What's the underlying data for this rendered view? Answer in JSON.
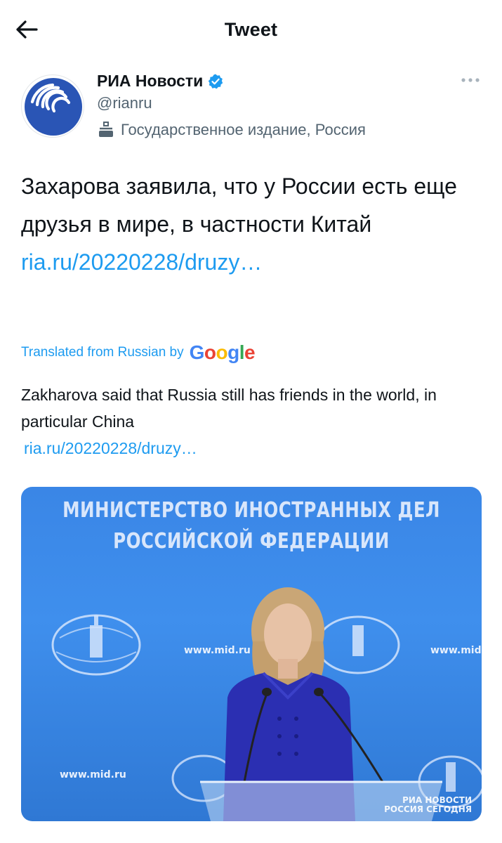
{
  "header": {
    "title": "Tweet"
  },
  "author": {
    "name": "РИА Новости",
    "handle": "@rianru",
    "label": "Государственное издание, Россия"
  },
  "tweet": {
    "text": "Захарова заявила, что у России есть еще друзья в мире, в частности Китай",
    "link": "ria.ru/20220228/druzy…"
  },
  "translation": {
    "note": "Translated from Russian by",
    "provider": "Google",
    "text": "Zakharova said that Russia still has friends in the world, in particular China",
    "link": "ria.ru/20220228/druzy…"
  },
  "media": {
    "banner_line1": "МИНИСТЕРСТВО ИНОСТРАННЫХ ДЕЛ",
    "banner_line2": "РОССИЙСКОЙ ФЕДЕРАЦИИ",
    "url_text": "www.mid.ru",
    "watermark_line1": "РИА НОВОСТИ",
    "watermark_line2": "РОССИЯ СЕГОДНЯ"
  },
  "colors": {
    "link": "#1d9bf0",
    "verified": "#1d9bf0",
    "secondary_text": "#536471",
    "media_background": "#3a86e6"
  },
  "icons": {
    "back": "arrow-left-icon",
    "verified": "verified-badge-icon",
    "state_media": "state-media-icon",
    "more": "more-dots-icon"
  }
}
